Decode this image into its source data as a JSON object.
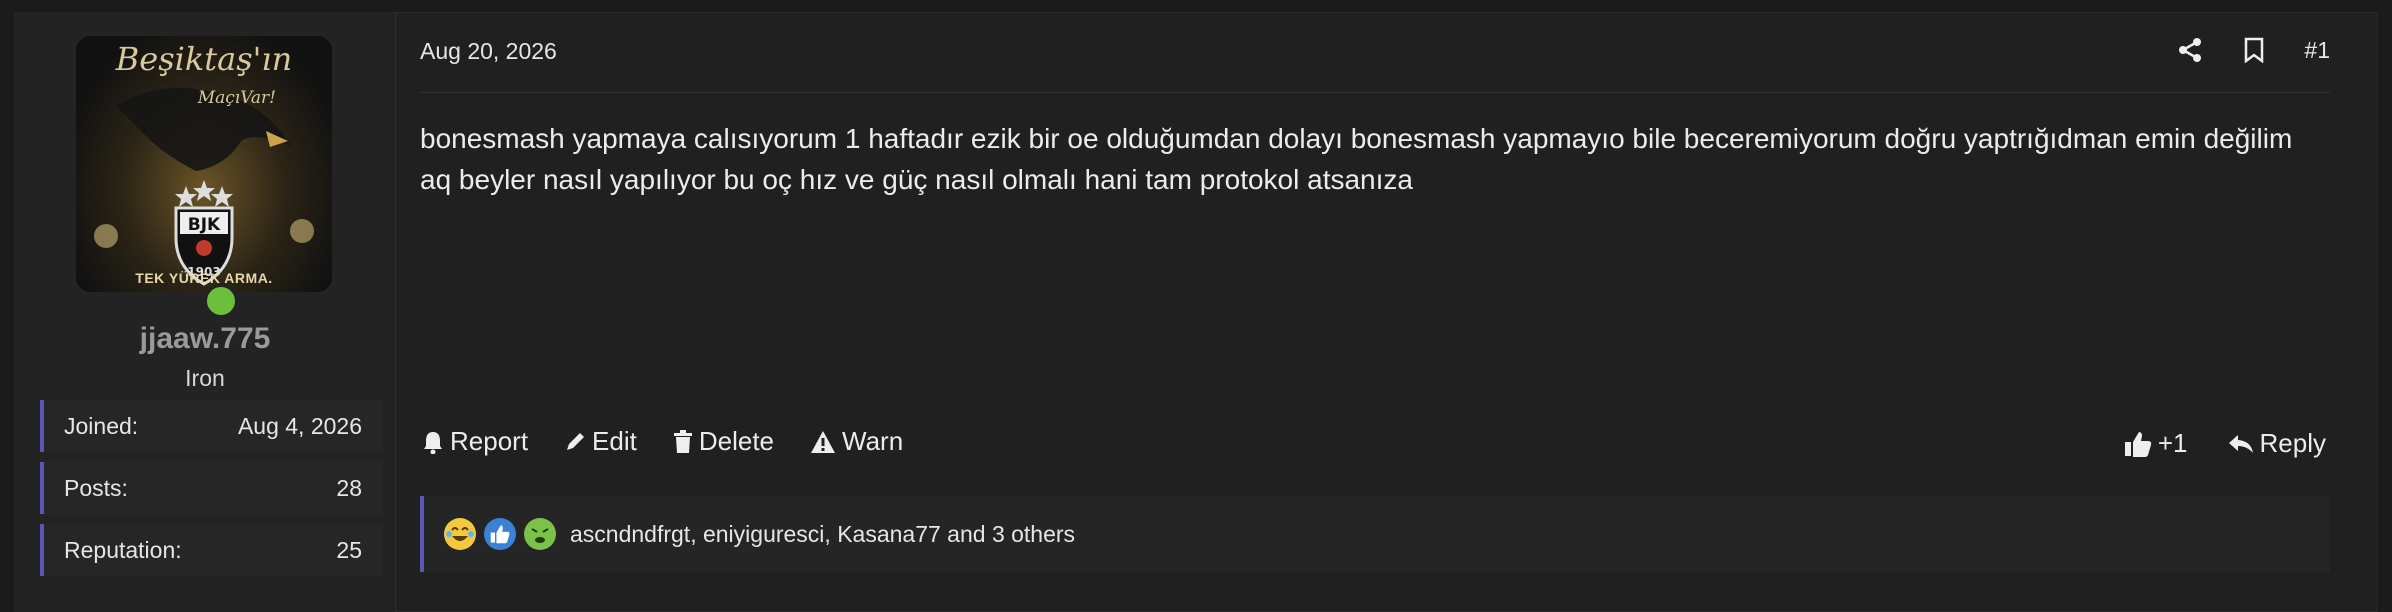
{
  "user": {
    "avatar_text_top": "Beşiktaş'ın",
    "avatar_text_sub": "MaçıVar!",
    "avatar_motto": "TEK YÜREK ARMA.",
    "username": "jjaaw.775",
    "title": "Iron",
    "stats": [
      {
        "label": "Joined:",
        "value": "Aug 4, 2026"
      },
      {
        "label": "Posts:",
        "value": "28"
      },
      {
        "label": "Reputation:",
        "value": "25"
      }
    ]
  },
  "post": {
    "date": "Aug 20, 2026",
    "number": "#1",
    "text": "bonesmash yapmaya calısıyorum 1 haftadır ezik bir oe olduğumdan dolayı bonesmash yapmayıo bile beceremiyorum doğru yaptrığıdman emin değilim aq beyler nasıl yapılıyor bu oç hız ve güç nasıl olmalı hani tam protokol atsanıza"
  },
  "actions": {
    "report": "Report",
    "edit": "Edit",
    "delete": "Delete",
    "warn": "Warn",
    "like_count": "+1",
    "reply": "Reply"
  },
  "reactions": {
    "names": "ascndndfrgt, eniyiguresci, Kasana77 and 3 others",
    "icons": [
      "laughing-crying-emoji-icon",
      "thumbs-up-emoji-icon",
      "sick-emoji-icon"
    ]
  },
  "colors": {
    "accent": "#5b57b5",
    "background": "#202020",
    "online": "#6bbf3a"
  }
}
